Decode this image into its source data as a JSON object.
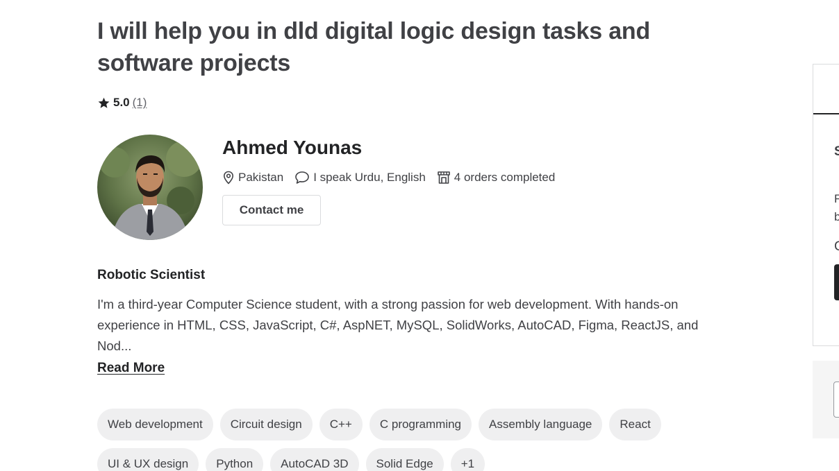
{
  "gig": {
    "title": "I will help you in dld digital logic design tasks and software projects",
    "rating": {
      "score": "5.0",
      "count": "(1)"
    }
  },
  "seller": {
    "name": "Ahmed Younas",
    "location": "Pakistan",
    "languages": "I speak Urdu, English",
    "orders": "4 orders completed",
    "contact_label": "Contact me",
    "profile_title": "Robotic Scientist",
    "description": "I'm a third-year Computer Science student, with a strong passion for web development. With hands-on experience in HTML, CSS, JavaScript, C#, AspNET, MySQL, SolidWorks, AutoCAD, Figma, ReactJS, and Nod...",
    "read_more": "Read More"
  },
  "skills": [
    "Web development",
    "Circuit design",
    "C++",
    "C programming",
    "Assembly language",
    "React",
    "UI & UX design",
    "Python",
    "AutoCAD 3D",
    "Solid Edge",
    "+1"
  ],
  "side_panel": {
    "heading_char": "S",
    "line1_char": "F",
    "line2_char": "b",
    "line3_char": "C"
  },
  "icons": {
    "rating": "star-icon",
    "location": "location-pin-icon",
    "languages": "chat-bubble-icon",
    "orders": "store-icon"
  },
  "colors": {
    "text": "#404145",
    "text_dark": "#222325",
    "tag_bg": "#efeff0",
    "border": "#dadbdd"
  }
}
